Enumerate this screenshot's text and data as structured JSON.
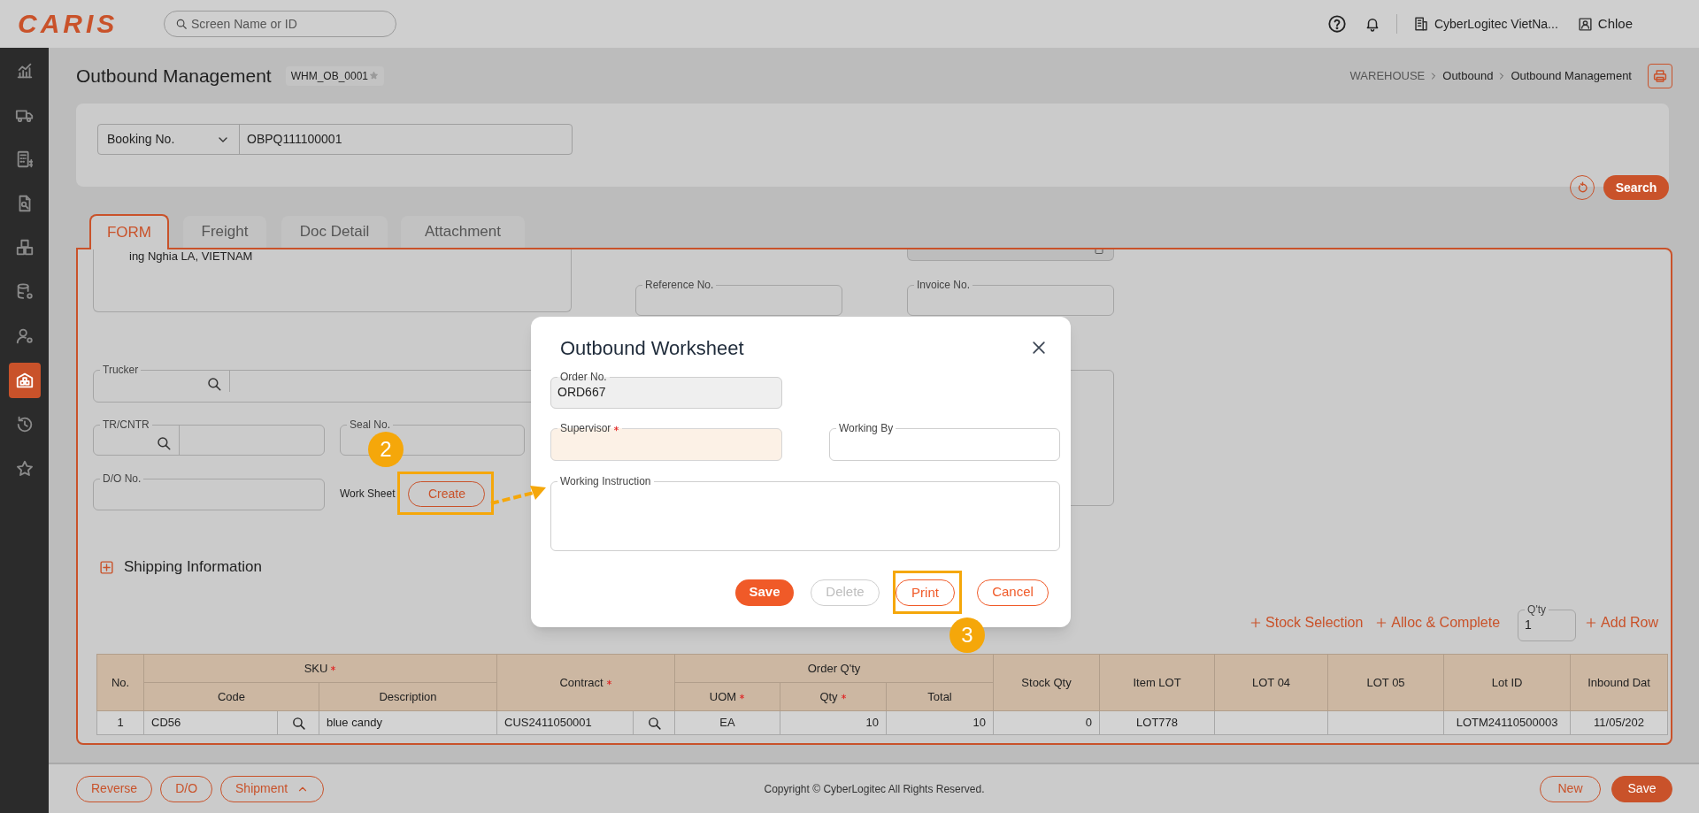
{
  "header": {
    "logo": "CARIS",
    "search_placeholder": "Screen Name or ID",
    "company": "CyberLogitec VietNa...",
    "user": "Chloe"
  },
  "sidebar": [
    {
      "selected": false
    },
    {
      "selected": false
    },
    {
      "selected": false
    },
    {
      "selected": false
    },
    {
      "selected": false
    },
    {
      "selected": false
    },
    {
      "selected": false
    },
    {
      "selected": true
    },
    {
      "selected": false
    },
    {
      "selected": false
    }
  ],
  "page": {
    "title": "Outbound Management",
    "screen_id": "WHM_OB_0001",
    "favorite": false,
    "breadcrumb": [
      "WAREHOUSE",
      "Outbound",
      "Outbound Management"
    ]
  },
  "search_panel": {
    "filter": "Booking No.",
    "value": "OBPQ111100001",
    "search_button": "Search"
  },
  "tabs": [
    {
      "label": "FORM",
      "selected": true
    },
    {
      "label": "Freight",
      "selected": false
    },
    {
      "label": "Doc Detail",
      "selected": false
    },
    {
      "label": "Attachment",
      "selected": false
    }
  ],
  "form": {
    "address": "ing Nghia LA, VIETNAM",
    "reference_no": {
      "label": "Reference No."
    },
    "invoice_no": {
      "label": "Invoice No."
    },
    "trucker": {
      "label": "Trucker"
    },
    "tr_cntr": {
      "label": "TR/CNTR"
    },
    "seal_no": {
      "label": "Seal No."
    },
    "do_no": {
      "label": "D/O No."
    },
    "work_sheet": {
      "label": "Work Sheet",
      "button": "Create",
      "highlighted": true
    }
  },
  "shipping_information": {
    "label": "Shipping Information",
    "expanded": false
  },
  "table_actions": {
    "stock_selection": "Stock Selection",
    "alloc_complete": "Alloc & Complete",
    "qty": {
      "label": "Q'ty",
      "value": "1"
    },
    "add_row": "Add Row"
  },
  "table": {
    "header": [
      {
        "label": "No."
      },
      {
        "label": "SKU",
        "required": true,
        "columns": [
          {
            "label": "Code",
            "lookup": true
          },
          {
            "label": "Description"
          }
        ]
      },
      {
        "label": "Contract",
        "required": true,
        "lookup": true
      },
      {
        "label": "Order Q'ty",
        "columns": [
          {
            "label": "UOM",
            "required": true
          },
          {
            "label": "Qty",
            "required": true
          },
          {
            "label": "Total"
          }
        ]
      },
      {
        "label": "Stock Qty"
      },
      {
        "label": "Item LOT"
      },
      {
        "label": "LOT 04"
      },
      {
        "label": "LOT 05"
      },
      {
        "label": "Lot ID"
      },
      {
        "label": "Inbound Dat"
      }
    ],
    "rows": [
      {
        "cells": [
          "1",
          "CD56",
          "blue candy",
          "CUS2411050001",
          "EA",
          "10",
          "10",
          "0",
          "LOT778",
          null,
          null,
          "LOTM24110500003",
          "11/05/202"
        ]
      }
    ]
  },
  "footer": {
    "left_buttons": [
      {
        "label": "Reverse",
        "has_menu": false
      },
      {
        "label": "D/O",
        "has_menu": false
      },
      {
        "label": "Shipment",
        "has_menu": true
      }
    ],
    "copyright": "Copyright © CyberLogitec All Rights Reserved.",
    "right_buttons": [
      {
        "label": "New",
        "kind": "outline"
      },
      {
        "label": "Save",
        "kind": "primary"
      }
    ]
  },
  "modal": {
    "title": "Outbound Worksheet",
    "order_no": {
      "label": "Order No.",
      "value": "ORD667"
    },
    "supervisor": {
      "label": "Supervisor",
      "required": true
    },
    "working_by": {
      "label": "Working By"
    },
    "working_instruction": {
      "label": "Working Instruction"
    },
    "buttons": [
      {
        "label": "Save",
        "kind": "primary",
        "disabled": false,
        "highlighted": false
      },
      {
        "label": "Delete",
        "kind": "outline",
        "disabled": true,
        "highlighted": false
      },
      {
        "label": "Print",
        "kind": "outline",
        "disabled": false,
        "highlighted": true
      },
      {
        "label": "Cancel",
        "kind": "outline",
        "disabled": false,
        "highlighted": false
      }
    ]
  },
  "callouts": [
    {
      "number": "2"
    },
    {
      "number": "3"
    }
  ]
}
